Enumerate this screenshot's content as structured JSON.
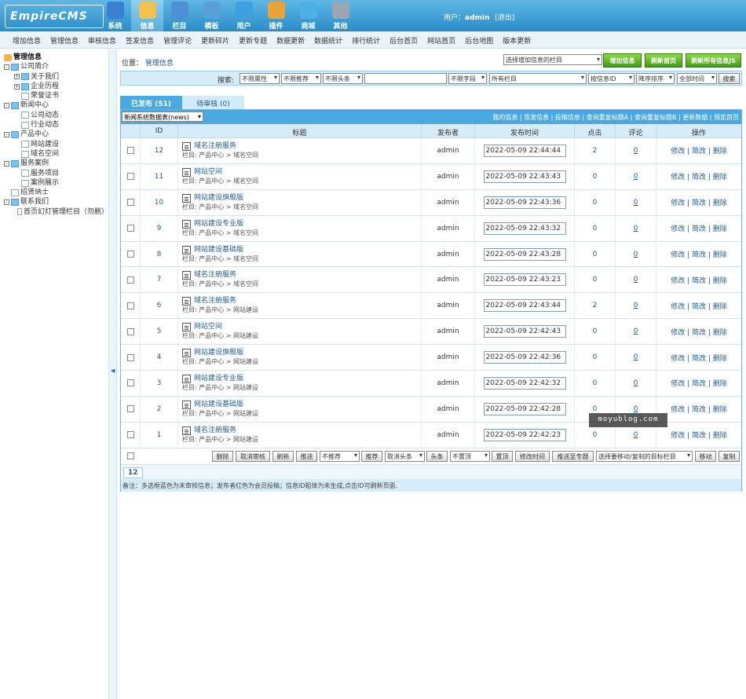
{
  "header": {
    "logo_text": "EmpireCMS",
    "nav": [
      {
        "label": "系统",
        "icon": "globe-icon",
        "color": "#3a7fd0"
      },
      {
        "label": "信息",
        "icon": "edit-document-icon",
        "color": "#f1c24e"
      },
      {
        "label": "栏目",
        "icon": "folder-icon",
        "color": "#4f8fd4"
      },
      {
        "label": "模板",
        "icon": "template-window-icon",
        "color": "#5aa0d8"
      },
      {
        "label": "用户",
        "icon": "user-icon",
        "color": "#3fa0e0"
      },
      {
        "label": "插件",
        "icon": "tools-icon",
        "color": "#e8a43a"
      },
      {
        "label": "商城",
        "icon": "shop-icon",
        "color": "#4fb0e6"
      },
      {
        "label": "其他",
        "icon": "gear-icon",
        "color": "#9aa7b2"
      }
    ],
    "user_prefix": "用户：",
    "user_name": "admin",
    "logout": "[退出]"
  },
  "subnav": [
    "增加信息",
    "管理信息",
    "审核信息",
    "签发信息",
    "管理评论",
    "更新碎片",
    "更新专题",
    "数据更新",
    "数据统计",
    "排行统计",
    "后台首页",
    "网站首页",
    "后台地图",
    "版本更新"
  ],
  "sidebar": {
    "root": "管理信息",
    "nodes": [
      {
        "label": "公司简介",
        "level": 0,
        "type": "folder",
        "pm": "⊟"
      },
      {
        "label": "关于我们",
        "level": 1,
        "type": "folder",
        "pm": "⊞"
      },
      {
        "label": "企业历程",
        "level": 1,
        "type": "folder",
        "pm": "⊞"
      },
      {
        "label": "荣誉证书",
        "level": 1,
        "type": "page",
        "pm": ""
      },
      {
        "label": "新闻中心",
        "level": 0,
        "type": "folder",
        "pm": "⊟"
      },
      {
        "label": "公司动态",
        "level": 1,
        "type": "page",
        "pm": ""
      },
      {
        "label": "行业动态",
        "level": 1,
        "type": "page",
        "pm": ""
      },
      {
        "label": "产品中心",
        "level": 0,
        "type": "folder",
        "pm": "⊟"
      },
      {
        "label": "网站建设",
        "level": 1,
        "type": "page",
        "pm": ""
      },
      {
        "label": "域名空间",
        "level": 1,
        "type": "page",
        "pm": ""
      },
      {
        "label": "服务案例",
        "level": 0,
        "type": "folder",
        "pm": "⊟"
      },
      {
        "label": "服务项目",
        "level": 1,
        "type": "page",
        "pm": ""
      },
      {
        "label": "案例展示",
        "level": 1,
        "type": "page",
        "pm": ""
      },
      {
        "label": "招贤纳士",
        "level": 0,
        "type": "page",
        "pm": ""
      },
      {
        "label": "联系我们",
        "level": 0,
        "type": "folder",
        "pm": "⊟"
      },
      {
        "label": "首页幻灯管理栏目（勿删）",
        "level": 1,
        "type": "page",
        "pm": ""
      }
    ]
  },
  "position": {
    "label": "位置：",
    "link": "管理信息"
  },
  "toolbar": {
    "column_select": "选择增加信息的栏目",
    "add_info": "增加信息",
    "refresh_home": "刷新首页",
    "refresh_js": "刷新所有信息JS"
  },
  "search": {
    "label": "搜索:",
    "attr": "不限属性",
    "recommend": "不限推荐",
    "headline": "不限头条",
    "keyword": "",
    "field": "不限字段",
    "column": "所有栏目",
    "sort_by": "按信息ID",
    "order": "降序排序",
    "time": "全部时间",
    "button": "搜索"
  },
  "tabs": {
    "published": "已发布 (51)",
    "pending": "待审核 (0)"
  },
  "table": {
    "table_select": "新闻系统数据表(news)",
    "links": "我的信息 | 签发信息 | 投稿信息 | 查询重复标题A | 查询重复标题B | 更新数据 | 预览首页",
    "headers": {
      "id": "ID",
      "title": "标题",
      "author": "发布者",
      "time": "发布时间",
      "clicks": "点击",
      "comments": "评论",
      "ops": "操作"
    },
    "ops_text": "修改 | 简改 | 删除",
    "path_prefix": "栏目: ",
    "rows": [
      {
        "id": "12",
        "title": "域名注册服务",
        "path": "产品中心 > 域名空间",
        "author": "admin",
        "time": "2022-05-09 22:44:44",
        "clicks": "2",
        "comments": "0"
      },
      {
        "id": "11",
        "title": "网站空间",
        "path": "产品中心 > 域名空间",
        "author": "admin",
        "time": "2022-05-09 22:43:43",
        "clicks": "0",
        "comments": "0"
      },
      {
        "id": "10",
        "title": "网站建设旗舰版",
        "path": "产品中心 > 域名空间",
        "author": "admin",
        "time": "2022-05-09 22:43:36",
        "clicks": "0",
        "comments": "0"
      },
      {
        "id": "9",
        "title": "网站建设专业版",
        "path": "产品中心 > 域名空间",
        "author": "admin",
        "time": "2022-05-09 22:43:32",
        "clicks": "0",
        "comments": "0"
      },
      {
        "id": "8",
        "title": "网站建设基础版",
        "path": "产品中心 > 域名空间",
        "author": "admin",
        "time": "2022-05-09 22:43:28",
        "clicks": "0",
        "comments": "0"
      },
      {
        "id": "7",
        "title": "域名注册服务",
        "path": "产品中心 > 域名空间",
        "author": "admin",
        "time": "2022-05-09 22:43:23",
        "clicks": "0",
        "comments": "0"
      },
      {
        "id": "6",
        "title": "域名注册服务",
        "path": "产品中心 > 网站建设",
        "author": "admin",
        "time": "2022-05-09 22:43:44",
        "clicks": "2",
        "comments": "0"
      },
      {
        "id": "5",
        "title": "网站空间",
        "path": "产品中心 > 网站建设",
        "author": "admin",
        "time": "2022-05-09 22:42:43",
        "clicks": "0",
        "comments": "0"
      },
      {
        "id": "4",
        "title": "网站建设旗舰版",
        "path": "产品中心 > 网站建设",
        "author": "admin",
        "time": "2022-05-09 22:42:36",
        "clicks": "0",
        "comments": "0"
      },
      {
        "id": "3",
        "title": "网站建设专业版",
        "path": "产品中心 > 网站建设",
        "author": "admin",
        "time": "2022-05-09 22:42:32",
        "clicks": "0",
        "comments": "0"
      },
      {
        "id": "2",
        "title": "网站建设基础版",
        "path": "产品中心 > 网站建设",
        "author": "admin",
        "time": "2022-05-09 22:42:28",
        "clicks": "0",
        "comments": "0"
      },
      {
        "id": "1",
        "title": "域名注册服务",
        "path": "产品中心 > 网站建设",
        "author": "admin",
        "time": "2022-05-09 22:42:23",
        "clicks": "0",
        "comments": "0"
      }
    ]
  },
  "actions": {
    "delete": "删除",
    "cancel_review": "取消审核",
    "refresh": "刷新",
    "push": "推送",
    "no_recommend": "不推荐",
    "recommend": "推荐",
    "cancel_headline": "取消头条",
    "headline": "头条",
    "no_top": "不置顶",
    "top": "置顶",
    "modify_time": "修改时间",
    "push_topic": "推送至专题",
    "target_column": "选择要移动/复制的目标栏目",
    "move": "移动",
    "copy": "复制"
  },
  "pagination": {
    "page": "12"
  },
  "note": "备注：多选框蓝色为未审核信息；发布者红色为会员投稿；信息ID粗体为未生成,点击ID可刷新页面.",
  "watermark": "moyublog.com"
}
